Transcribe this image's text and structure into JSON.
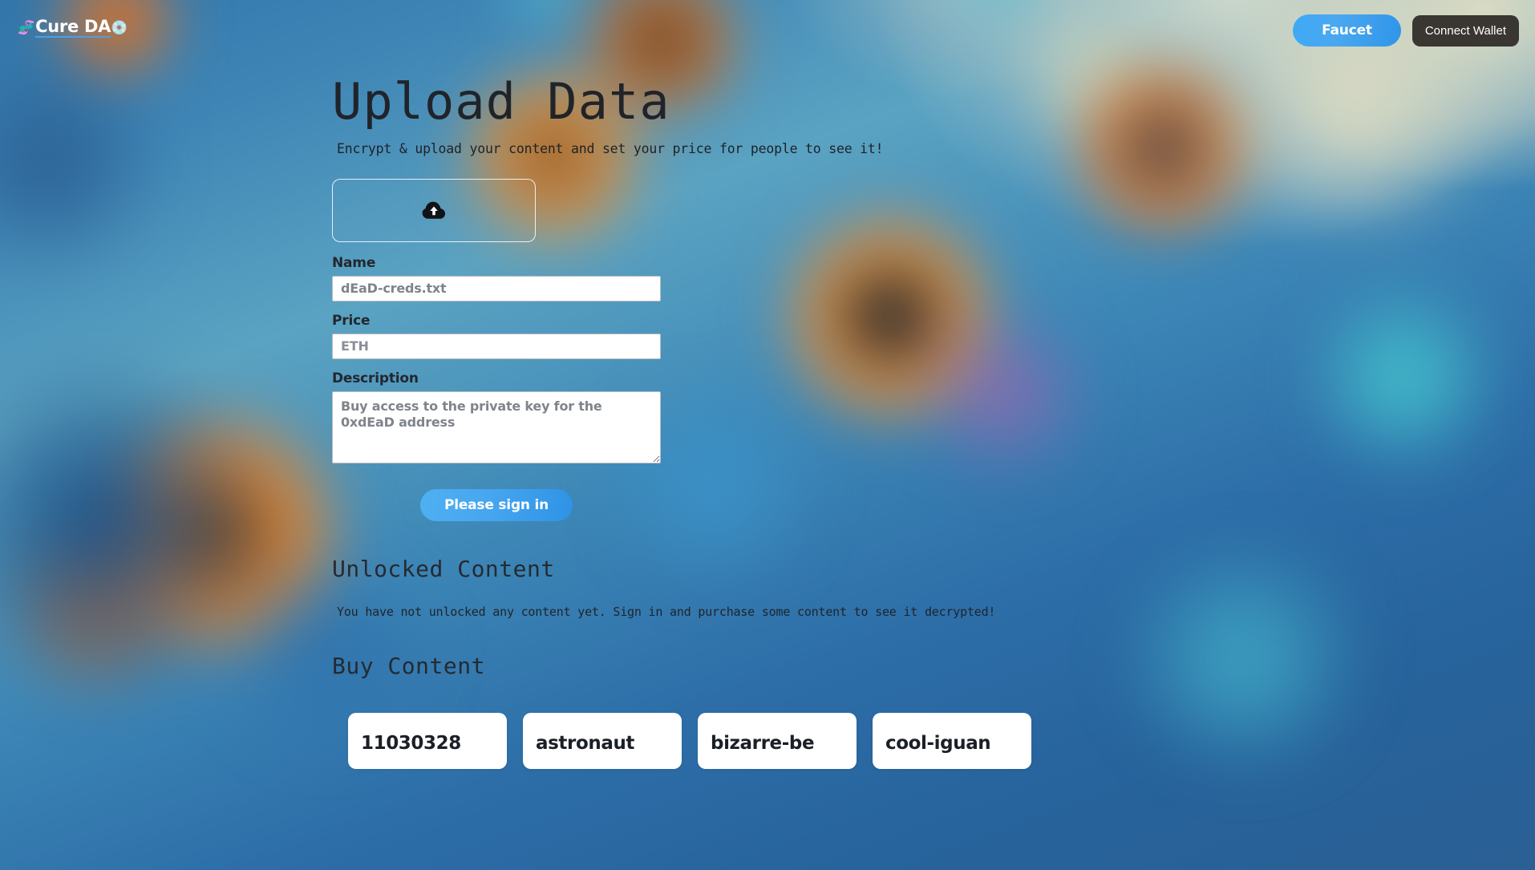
{
  "header": {
    "brand_emoji_left": "🧬",
    "brand_text": "Cure DA",
    "brand_emoji_right": "💿",
    "faucet_label": "Faucet",
    "connect_wallet_label": "Connect Wallet",
    "accent_blue": "#3fa9f5",
    "connect_dark": "#3a3631"
  },
  "main": {
    "title": "Upload Data",
    "subtitle": "Encrypt & upload your content and set your price for people to see it!",
    "dropzone_icon": "cloud-upload-icon",
    "form": {
      "name_label": "Name",
      "name_value": "dEaD-creds.txt",
      "name_placeholder": "Name",
      "price_label": "Price",
      "price_value": "",
      "price_placeholder": "ETH",
      "description_label": "Description",
      "description_value": "Buy access to the private key for the 0xdEaD address",
      "description_placeholder": "Description"
    },
    "submit_label": "Please sign in"
  },
  "unlocked": {
    "heading": "Unlocked Content",
    "empty_message": "You have not unlocked any content yet. Sign in and purchase some content to see it decrypted!"
  },
  "buy": {
    "heading": "Buy Content",
    "cards": [
      {
        "title": "11030328"
      },
      {
        "title": "astronaut"
      },
      {
        "title": "bizarre-be"
      },
      {
        "title": "cool-iguan"
      }
    ]
  }
}
